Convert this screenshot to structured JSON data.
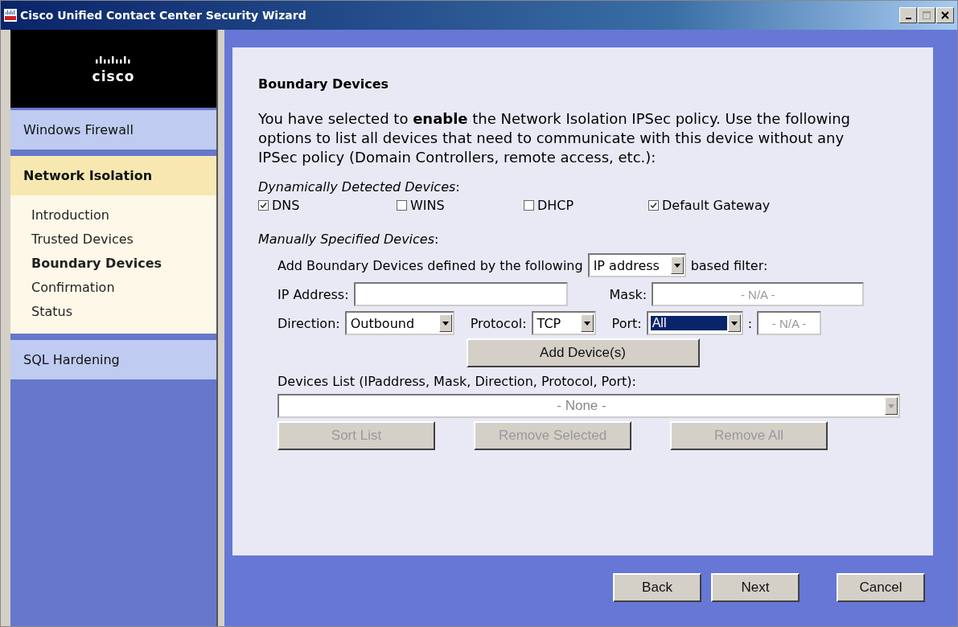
{
  "window": {
    "title": "Cisco Unified Contact Center Security Wizard"
  },
  "logo": {
    "text": "cisco"
  },
  "sidebar": {
    "sections": [
      {
        "label": "Windows Firewall",
        "selected": false
      },
      {
        "label": "Network Isolation",
        "selected": true,
        "children": [
          {
            "label": "Introduction",
            "selected": false
          },
          {
            "label": "Trusted Devices",
            "selected": false
          },
          {
            "label": "Boundary Devices",
            "selected": true
          },
          {
            "label": "Confirmation",
            "selected": false
          },
          {
            "label": "Status",
            "selected": false
          }
        ]
      },
      {
        "label": "SQL Hardening",
        "selected": false
      }
    ]
  },
  "page": {
    "heading": "Boundary Devices",
    "intro": "You have selected to **enable** the Network Isolation IPSec policy. Use the following options to list all devices that need to communicate with this device without any IPSec policy (Domain Controllers, remote access, etc.):",
    "dynamic": {
      "label": "*Dynamically Detected Devices*:",
      "checkboxes": [
        {
          "label": "DNS",
          "checked": true
        },
        {
          "label": "WINS",
          "checked": false
        },
        {
          "label": "DHCP",
          "checked": false
        },
        {
          "label": "Default Gateway",
          "checked": true
        }
      ]
    },
    "manual": {
      "label": "*Manually Specified Devices*:",
      "filter": {
        "prefix": "Add Boundary Devices defined by the following",
        "value": "IP address",
        "suffix": "based filter:"
      },
      "ip_address": {
        "label": "IP Address:"
      },
      "mask": {
        "label": "Mask:",
        "placeholder": "- N/A -",
        "disabled": true
      },
      "direction": {
        "label": "Direction:",
        "value": "Outbound"
      },
      "protocol": {
        "label": "Protocol:",
        "value": "TCP"
      },
      "port": {
        "label": "Port:",
        "value": "All",
        "focused": true
      },
      "port_separator": ":",
      "port_number": {
        "placeholder": "- N/A -",
        "disabled": true
      },
      "add_button": {
        "label": "Add Device(s)",
        "disabled": false
      }
    },
    "devices_list": {
      "label": "Devices List (IPaddress, Mask, Direction, Protocol, Port):",
      "value": "- None -"
    },
    "list_buttons": [
      {
        "label": "Sort List",
        "disabled": true
      },
      {
        "label": "Remove Selected",
        "disabled": true
      },
      {
        "label": "Remove All",
        "disabled": true
      }
    ]
  },
  "footer_buttons": [
    {
      "label": "Back",
      "disabled": false
    },
    {
      "label": "Next",
      "disabled": false
    },
    {
      "label": "Cancel",
      "disabled": false
    }
  ]
}
